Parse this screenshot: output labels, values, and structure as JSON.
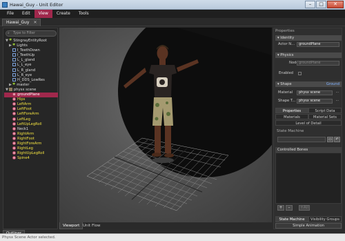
{
  "window": {
    "title": "Hawai_Guy - Unit Editor",
    "min": "–",
    "max": "□",
    "close": "✕"
  },
  "menu": [
    "File",
    "Edit",
    "View",
    "Create",
    "Tools"
  ],
  "menu_active": "View",
  "doc_tab": {
    "label": "Hawai_Guy",
    "close": "✕"
  },
  "outliner": {
    "filter_placeholder": "Type to Filter",
    "tab": "Outliner",
    "items": [
      {
        "label": "StingrayEntityRoot",
        "icon": "gear-icon",
        "depth": 0,
        "twisty": "▼"
      },
      {
        "label": "Lights",
        "icon": "gear-icon",
        "depth": 1,
        "twisty": "▶"
      },
      {
        "label": "I_TeethDown",
        "icon": "mesh-icon",
        "depth": 1
      },
      {
        "label": "I_TeethUp",
        "icon": "mesh-icon",
        "depth": 1
      },
      {
        "label": "L_L_gland",
        "icon": "mesh-icon",
        "depth": 1
      },
      {
        "label": "L_L_eye",
        "icon": "mesh-icon",
        "depth": 1
      },
      {
        "label": "L_R_gland",
        "icon": "mesh-icon",
        "depth": 1
      },
      {
        "label": "L_R_eye",
        "icon": "mesh-icon",
        "depth": 1
      },
      {
        "label": "H_DDS_LowRes",
        "icon": "mesh-icon",
        "depth": 1
      },
      {
        "label": "master",
        "icon": "gear-icon",
        "depth": 1,
        "twisty": "▶"
      },
      {
        "label": "physx scene",
        "icon": "folder-icon",
        "depth": 0,
        "twisty": "▼"
      },
      {
        "label": "groundPlane",
        "icon": "bone-icon",
        "depth": 1,
        "selected": true
      },
      {
        "label": "Hips",
        "icon": "bone-icon",
        "depth": 1,
        "yellow": true
      },
      {
        "label": "LeftArm",
        "icon": "bone-icon",
        "depth": 1,
        "yellow": true
      },
      {
        "label": "LeftFoot",
        "icon": "bone-icon",
        "depth": 1,
        "yellow": true
      },
      {
        "label": "LeftForeArm",
        "icon": "bone-icon",
        "depth": 1,
        "yellow": true
      },
      {
        "label": "LeftLeg",
        "icon": "bone-icon",
        "depth": 1,
        "yellow": true
      },
      {
        "label": "LeftUpLegRoll",
        "icon": "bone-icon",
        "depth": 1,
        "yellow": true
      },
      {
        "label": "Neck1",
        "icon": "bone-icon",
        "depth": 1
      },
      {
        "label": "RightArm",
        "icon": "bone-icon",
        "depth": 1,
        "yellow": true
      },
      {
        "label": "RightFoot",
        "icon": "bone-icon",
        "depth": 1,
        "yellow": true
      },
      {
        "label": "RightForeArm",
        "icon": "bone-icon",
        "depth": 1,
        "yellow": true
      },
      {
        "label": "RightLeg",
        "icon": "bone-icon",
        "depth": 1,
        "yellow": true
      },
      {
        "label": "RightUpLegRoll",
        "icon": "bone-icon",
        "depth": 1,
        "yellow": true
      },
      {
        "label": "Spine4",
        "icon": "bone-icon",
        "depth": 1,
        "yellow": true
      }
    ]
  },
  "viewport": {
    "tabs": [
      "Viewport",
      "Unit Flow"
    ],
    "active_tab": "Viewport"
  },
  "properties": {
    "title": "Properties",
    "identity": {
      "header": "Identity",
      "actor_label": "Actor N...",
      "actor_value": "groundPlane"
    },
    "physics": {
      "header": "Physics",
      "node_label": "Node",
      "node_value": "groundPlane",
      "enabled_label": "Enabled"
    },
    "shape": {
      "header": "Shape",
      "type": "Ground",
      "material_label": "Material",
      "material_value": "physx scene",
      "shape_label": "Shape T...",
      "shape_value": "physx scene"
    },
    "tabs_row1": [
      "Properties",
      "Script Data"
    ],
    "tabs_row2": [
      "Materials",
      "Material Sets"
    ],
    "tab_lod": "Level of Detail",
    "active_tab": "Properties"
  },
  "state_machine": {
    "title": "State Machine",
    "list_title": "Controlled Bones",
    "add": "+",
    "remove": "–",
    "add_all": "+All",
    "bottom_tabs": [
      "State Machine",
      "Visibility Groups"
    ],
    "active_tab": "State Machine",
    "simple_animation": "Simple Animation"
  },
  "status": "Physx Scene Actor selected."
}
